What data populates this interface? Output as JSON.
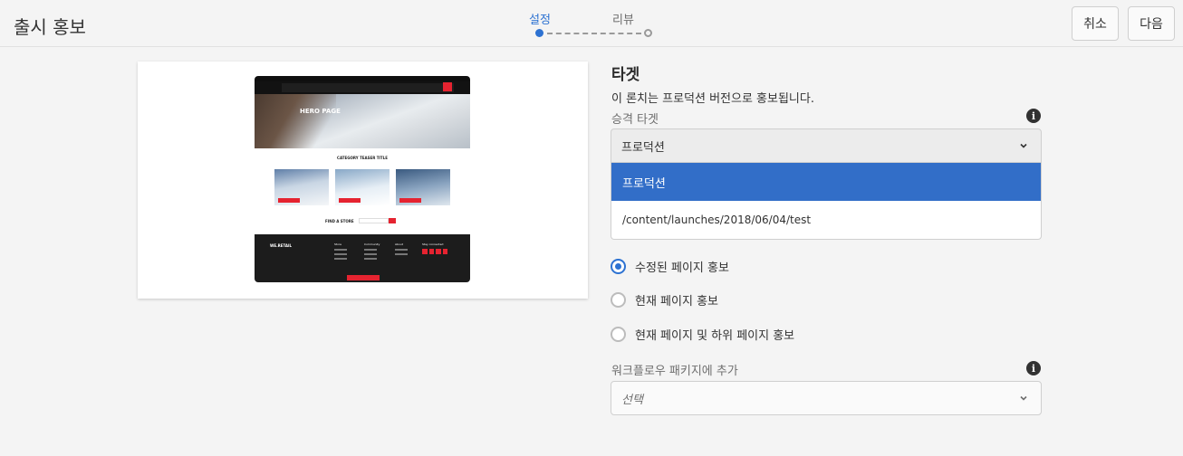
{
  "header": {
    "title": "출시 홍보",
    "steps": [
      {
        "label": "설정",
        "active": true
      },
      {
        "label": "리뷰",
        "active": false
      }
    ],
    "cancel_label": "취소",
    "next_label": "다음"
  },
  "preview": {
    "hero_title": "HERO PAGE",
    "category_title": "CATEGORY TEASER TITLE",
    "find_store": "FIND A STORE",
    "footer_logo": "WE.RETAIL",
    "footer_cols": [
      "Store",
      "Community",
      "About",
      "Stay connected"
    ]
  },
  "form": {
    "section_title": "타겟",
    "description": "이 론치는 프로덕션 버전으로 홍보됩니다.",
    "target_label": "승격 타겟",
    "target_value": "프로덕션",
    "target_options": [
      "프로덕션",
      "/content/launches/2018/06/04/test"
    ],
    "radio_options": [
      {
        "label": "수정된 페이지 홍보",
        "checked": true
      },
      {
        "label": "현재 페이지 홍보",
        "checked": false
      },
      {
        "label": "현재 페이지 및 하위 페이지 홍보",
        "checked": false
      }
    ],
    "workflow_label": "워크플로우 패키지에 추가",
    "workflow_placeholder": "선택"
  },
  "colors": {
    "accent": "#2d72d2",
    "selected_option_bg": "#326ec8"
  },
  "icons": {
    "info": "info-icon",
    "chevron": "chevron-down-icon"
  }
}
